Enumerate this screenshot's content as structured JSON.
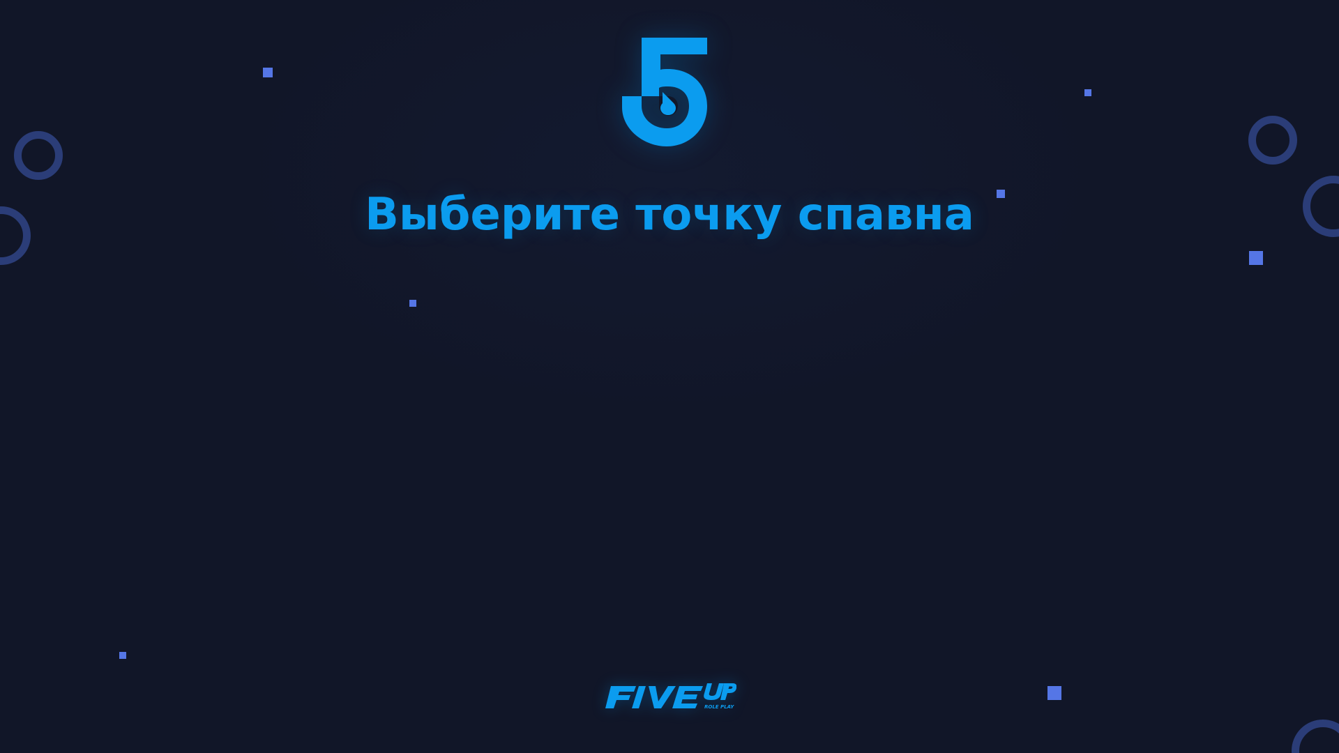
{
  "screen": {
    "title": "Выберите точку спавна"
  },
  "brand": {
    "name": "FIVE UP",
    "tagline": "ROLE PLAY"
  },
  "icons": {
    "logo": "five-up-5-logo-icon",
    "decor_rings": "ring-icon",
    "decor_squares": "square-icon"
  },
  "colors": {
    "background": "#111628",
    "accent": "#0b9cef",
    "decor_square": "#5576e6",
    "decor_ring": "#2b3d78"
  }
}
